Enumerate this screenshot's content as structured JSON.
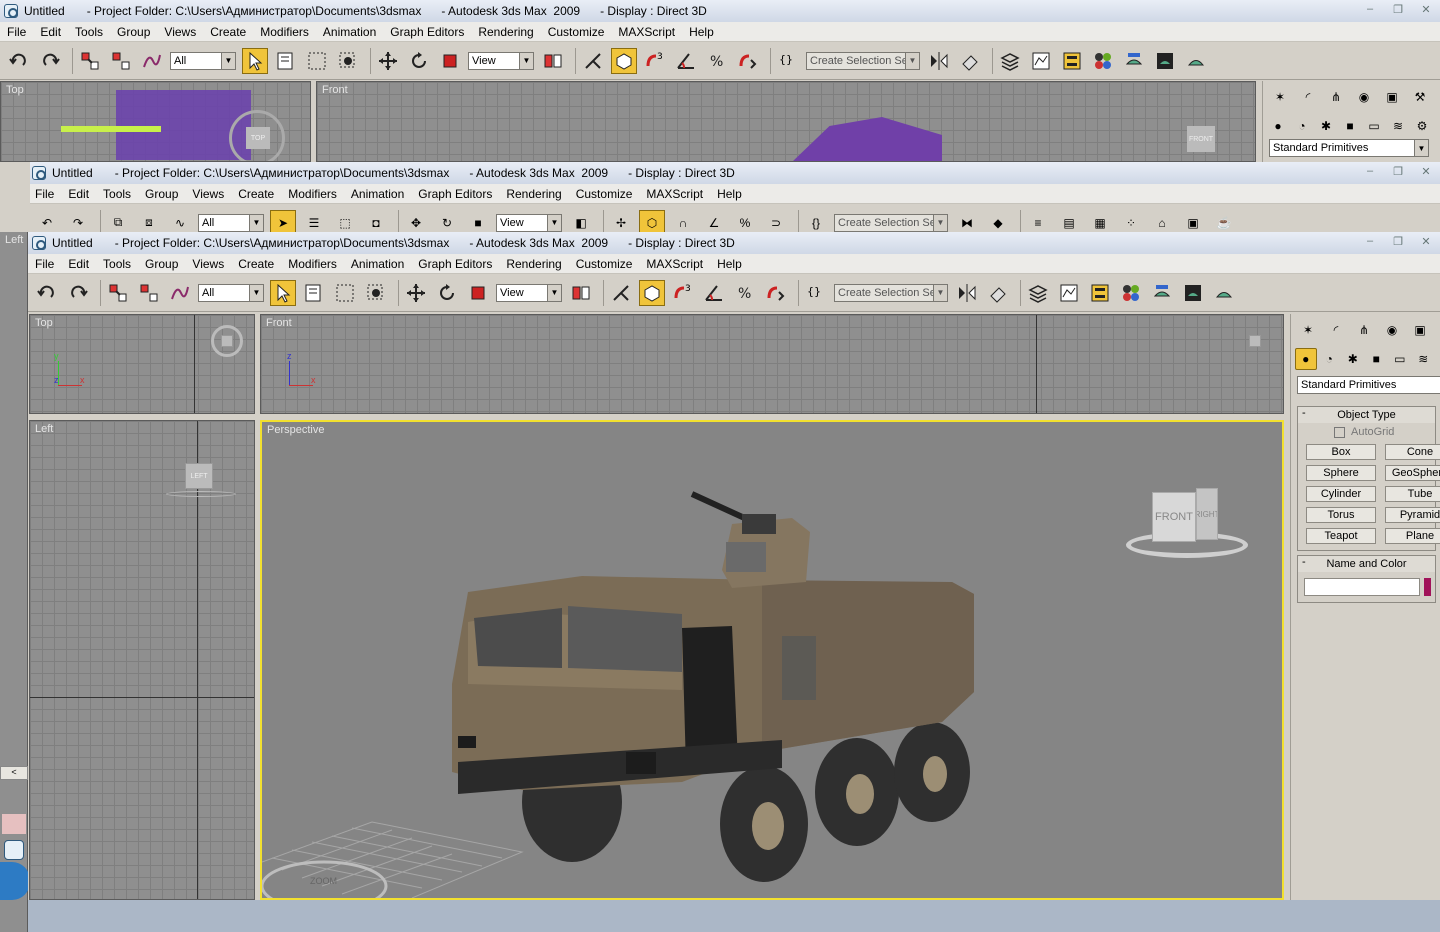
{
  "window": {
    "app_label": "Untitled",
    "title": "- Project Folder: C:\\Users\\Администратор\\Documents\\3dsmax      - Autodesk 3ds Max  2009      - Display : Direct 3D",
    "controls": [
      "–",
      "❐",
      "✕"
    ]
  },
  "menu": [
    "File",
    "Edit",
    "Tools",
    "Group",
    "Views",
    "Create",
    "Modifiers",
    "Animation",
    "Graph Editors",
    "Rendering",
    "Customize",
    "MAXScript",
    "Help"
  ],
  "toolbar": {
    "selection_filter": "All",
    "reference_coord": "View",
    "named_selection_placeholder": "Create Selection Set",
    "active_color": "#f0c43a"
  },
  "viewports": {
    "top": "Top",
    "front": "Front",
    "left": "Left",
    "perspective": "Perspective",
    "active_border_color": "#f2e02e"
  },
  "viewcube": {
    "front": "FRONT",
    "right": "RIGHT",
    "top": "TOP",
    "left": "LEFT",
    "zoom": "ZOOM"
  },
  "axes": {
    "x": "x",
    "y": "y",
    "z": "z"
  },
  "command_panel": {
    "category": "Standard Primitives",
    "object_type_title": "Object Type",
    "autogrid_label": "AutoGrid",
    "primitives": [
      "Box",
      "Cone",
      "Sphere",
      "GeoSphere",
      "Cylinder",
      "Tube",
      "Torus",
      "Pyramid",
      "Teapot",
      "Plane"
    ],
    "name_color_title": "Name and Color",
    "object_color": "#a1135a"
  }
}
